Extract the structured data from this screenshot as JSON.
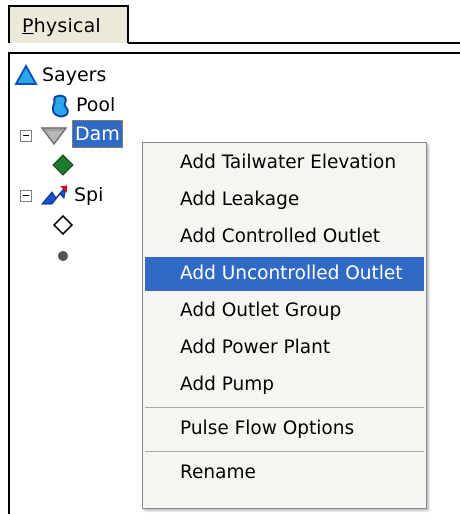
{
  "tab": {
    "label_accel": "P",
    "label_rest": "hysical"
  },
  "tree": {
    "root": {
      "label": "Sayers",
      "icon": "reservoir-triangle-icon",
      "color": "#1e9bd8"
    },
    "pool": {
      "label": "Pool",
      "icon": "pool-icon",
      "color": "#1e9bd8"
    },
    "dam": {
      "label": "Dam",
      "icon": "dam-icon",
      "selected": true
    },
    "dam_child": {
      "icon": "tailwater-diamond-icon",
      "color": "#1a6b2a"
    },
    "spillway": {
      "label": "Spi",
      "icon": "spillway-icon"
    },
    "spillway_child1": {
      "icon": "outlet-diamond-icon"
    },
    "spillway_child2": {
      "icon": "outlet-dot-icon"
    }
  },
  "context_menu": {
    "items": [
      {
        "label": "Add Tailwater Elevation"
      },
      {
        "label": "Add Leakage"
      },
      {
        "label": "Add Controlled Outlet"
      },
      {
        "label": "Add Uncontrolled Outlet",
        "highlighted": true
      },
      {
        "label": "Add Outlet Group"
      },
      {
        "label": "Add Power Plant"
      },
      {
        "label": "Add Pump"
      },
      {
        "label": "Pulse Flow Options"
      },
      {
        "label": "Rename"
      }
    ]
  },
  "colors": {
    "selection": "#316ac5",
    "menu_bg": "#f6f5f1",
    "tab_bg": "#ece9d8"
  }
}
